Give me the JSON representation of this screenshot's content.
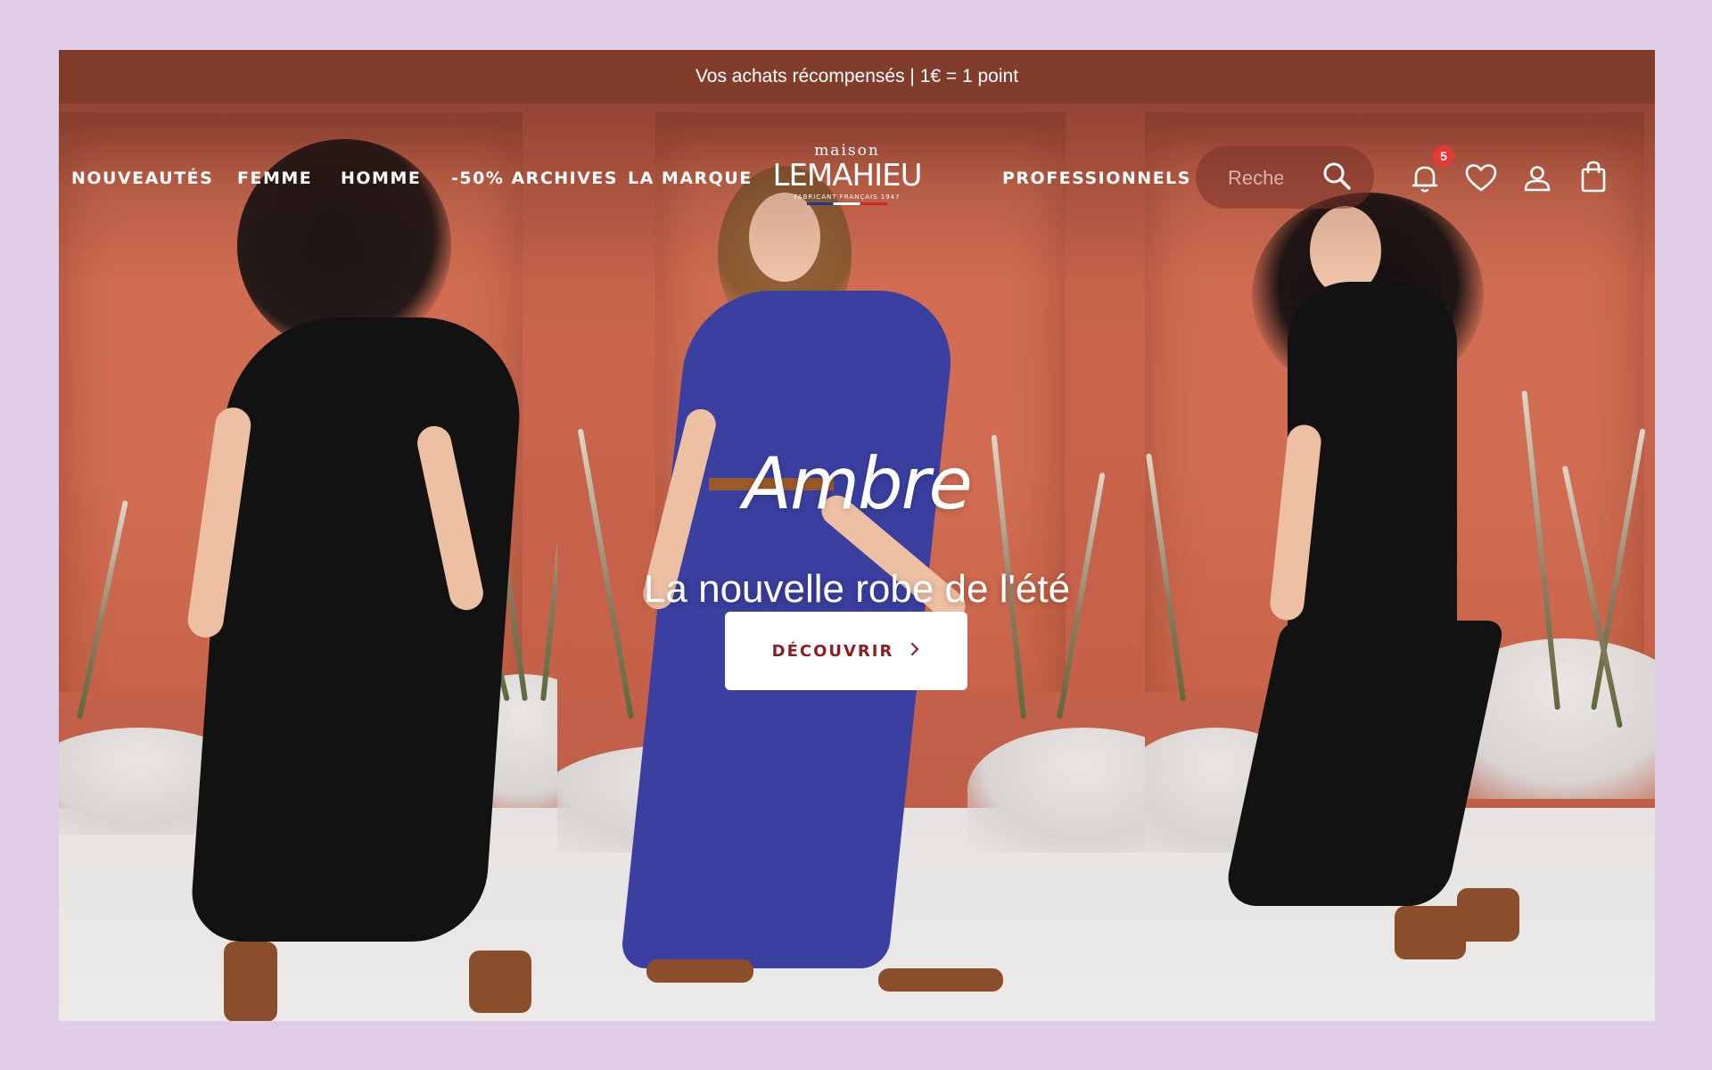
{
  "promo_bar": {
    "text": "Vos achats récompensés | 1€ = 1 point"
  },
  "nav": {
    "left_items": [
      "NOUVEAUTÉS",
      "FEMME",
      "HOMME",
      "-50% ARCHIVES",
      "LA MARQUE"
    ],
    "right_items": [
      "PROFESSIONNELS"
    ]
  },
  "logo": {
    "top": "maison",
    "main": "LEMAHIEU",
    "sub": "FABRICANT FRANÇAIS 1947"
  },
  "search": {
    "placeholder": "Rechercher"
  },
  "header_icons": {
    "search": "search-icon",
    "notifications": "bell-icon",
    "notification_count": "5",
    "wishlist": "heart-icon",
    "account": "user-icon",
    "cart": "shopping-bag-icon"
  },
  "hero": {
    "title": "Ambre",
    "subtitle": "La nouvelle robe de l'été",
    "cta_label": "DÉCOUVRIR",
    "cta_icon": "chevron-right-icon"
  },
  "colors": {
    "page_background": "#dfcde8",
    "cta_text": "#8e1e22",
    "badge": "#e53935",
    "backdrop": "#c4624a"
  }
}
